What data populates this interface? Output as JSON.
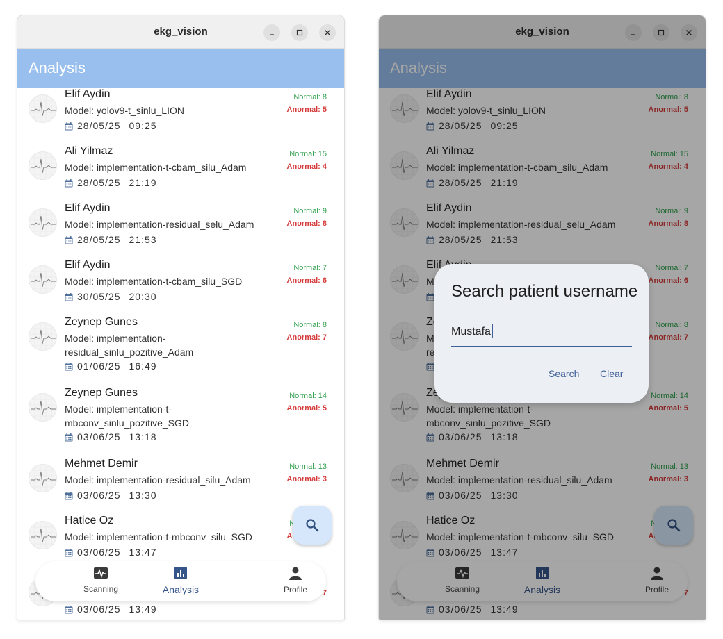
{
  "window": {
    "title": "ekg_vision"
  },
  "appbar": {
    "title": "Analysis"
  },
  "model_prefix": "Model: ",
  "items": [
    {
      "name": "Elif Aydin",
      "model": "Model: yolov9-t_sinlu_LION",
      "date": "28/05/25",
      "time": "09:25",
      "normal": "Normal: 8",
      "anormal": "Anormal: 5"
    },
    {
      "name": "Ali Yilmaz",
      "model": "Model: implementation-t-cbam_silu_Adam",
      "date": "28/05/25",
      "time": "21:19",
      "normal": "Normal: 15",
      "anormal": "Anormal: 4"
    },
    {
      "name": "Elif Aydin",
      "model": "Model: implementation-residual_selu_Adam",
      "date": "28/05/25",
      "time": "21:53",
      "normal": "Normal: 9",
      "anormal": "Anormal: 8"
    },
    {
      "name": "Elif Aydin",
      "model": "Model: implementation-t-cbam_silu_SGD",
      "date": "30/05/25",
      "time": "20:30",
      "normal": "Normal: 7",
      "anormal": "Anormal: 6"
    },
    {
      "name": "Zeynep Gunes",
      "model_line1": "Model: implementation-",
      "model_line2": "residual_sinlu_pozitive_Adam",
      "date": "01/06/25",
      "time": "16:49",
      "normal": "Normal: 8",
      "anormal": "Anormal: 7"
    },
    {
      "name": "Zeynep Gunes",
      "model_line1": "Model: implementation-t-",
      "model_line2": "mbconv_sinlu_pozitive_SGD",
      "date": "03/06/25",
      "time": "13:18",
      "normal": "Normal: 14",
      "anormal": "Anormal: 5"
    },
    {
      "name": "Mehmet Demir",
      "model": "Model: implementation-residual_silu_Adam",
      "date": "03/06/25",
      "time": "13:30",
      "normal": "Normal: 13",
      "anormal": "Anormal: 3"
    },
    {
      "name": "Hatice Oz",
      "model": "Model: implementation-t-mbconv_silu_SGD",
      "date": "03/06/25",
      "time": "13:47",
      "normal": "Normal: 14",
      "anormal": "Anormal: 5"
    },
    {
      "name": "",
      "model": "",
      "date": "03/06/25",
      "time": "13:49",
      "normal": "",
      "anormal": "7"
    }
  ],
  "fab": {
    "icon": "search-icon"
  },
  "nav": {
    "scanning": {
      "label": "Scanning",
      "icon": "ekg-monitor-icon"
    },
    "analysis": {
      "label": "Analysis",
      "icon": "bar-chart-icon"
    },
    "profile": {
      "label": "Profile",
      "icon": "person-icon"
    }
  },
  "dialog": {
    "title": "Search patient username",
    "input_value": "Mustafa",
    "search_label": "Search",
    "clear_label": "Clear"
  },
  "colors": {
    "appbar": "#98bfee",
    "normal": "#31a04e",
    "anormal": "#d63c3c",
    "accent": "#3f5f99"
  }
}
